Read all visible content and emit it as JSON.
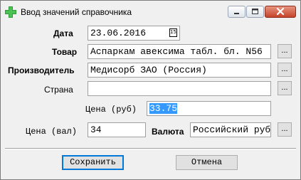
{
  "window": {
    "title": "Ввод значений справочника"
  },
  "form": {
    "date": {
      "label": "Дата",
      "value": "23.06.2016"
    },
    "product": {
      "label": "Товар",
      "value": "Аспаркам авексима табл. бл. N56"
    },
    "manufacturer": {
      "label": "Производитель",
      "value": "Медисорб ЗАО (Россия)"
    },
    "country": {
      "label": "Страна",
      "value": ""
    },
    "price_rub": {
      "label": "Цена (руб)",
      "value": "33.75"
    },
    "price_cur": {
      "label": "Цена (вал)",
      "value": "34"
    },
    "currency": {
      "label": "Валюта",
      "value": "Российский рубль"
    },
    "browse_label": "..."
  },
  "buttons": {
    "save": "Сохранить",
    "cancel": "Отмена"
  },
  "icons": {
    "app": "green-cross-icon",
    "calendar": "calendar-icon",
    "calendar_day": "15"
  }
}
